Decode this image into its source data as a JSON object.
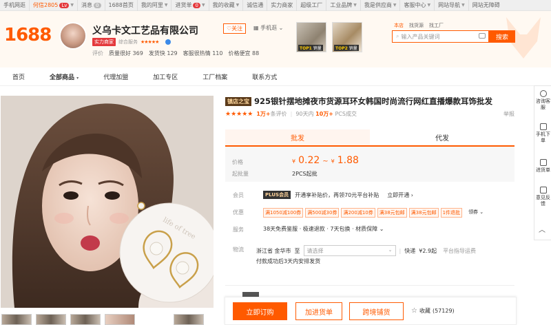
{
  "topbar": {
    "mobile": "手机网逛",
    "user": "何信2805",
    "level": "Lv",
    "messages": "消息",
    "message_count": "0",
    "links": [
      "1688首页",
      "我的阿里",
      "进货单",
      "我的收藏",
      "诚信通",
      "实力商家",
      "超级工厂",
      "工业品牌",
      "我是供应商",
      "客服中心",
      "网站导航",
      "网站无障碍"
    ],
    "cart_count": "0"
  },
  "header": {
    "logo": "1688",
    "company": "义乌卡文工艺品有限公司",
    "shili": "实力商家",
    "stars_label": "综合服务",
    "stars": "★★★★★",
    "score_label": "评价",
    "scores": [
      {
        "label": "质量很好",
        "value": "369"
      },
      {
        "label": "发货快",
        "value": "129"
      },
      {
        "label": "客服很热情",
        "value": "110"
      },
      {
        "label": "价格便宜",
        "value": "88"
      }
    ],
    "follow": "关注",
    "mobile_shop": "手机逛",
    "thumbs": [
      {
        "rank": "TOP1",
        "label": "销量"
      },
      {
        "rank": "TOP2",
        "label": "销量"
      }
    ],
    "search_tabs": [
      "本店",
      "找货源",
      "找工厂"
    ],
    "search_placeholder": "输入产品关键词",
    "search_button": "搜索"
  },
  "nav": {
    "items": [
      "首页",
      "全部商品",
      "代理加盟",
      "加工专区",
      "工厂档案",
      "联系方式"
    ]
  },
  "product": {
    "shop_badge": "镇店之宝",
    "title": "925银针摆地摊夜市货源耳环女韩国时尚流行网红直播爆款耳饰批发",
    "stars": "★★★★★",
    "reviews_num": "1万+",
    "reviews_label": "条评价",
    "days": "90天内",
    "sold_num": "10万+",
    "sold_label": "PCS成交",
    "report": "举报",
    "tabs": [
      "批发",
      "代发"
    ],
    "price_label": "价格",
    "currency": "¥",
    "price_min": "0.22",
    "price_max": "1.88",
    "min_order_label": "起批量",
    "min_order": "2PCS起批",
    "member_label": "会员",
    "plus_text": "PLUS会员",
    "plus_desc": "开通享补贴价，再领70元平台补贴",
    "plus_open": "立即开通",
    "coupon_label": "优惠",
    "coupons": [
      "满1050减100券",
      "满500减30券",
      "满200减10券",
      "满38元包邮",
      "满38元包邮",
      "1件退批"
    ],
    "coupon_more": "领券",
    "service_label": "服务",
    "service": "38天免费鉴服 · 极速退款 · 7天包换 · 材质保障",
    "logistics_label": "物流",
    "origin": "浙江省 金华市",
    "to": "至",
    "dest_placeholder": "请选择",
    "express": "快递",
    "express_fee": "¥2.9起",
    "platform_fee": "平台指导运费",
    "ship_note": "付款成功后3天内安排发货",
    "buy_now": "立即订购",
    "add_cart": "加进货单",
    "distribute": "跨境铺货",
    "fav_label": "收藏",
    "fav_count": "(57129)",
    "watermark_text": "life of tree"
  },
  "sidebar": {
    "items": [
      "咨询客服",
      "手机下单",
      "进货单",
      "意见反馈"
    ]
  },
  "colors": {
    "accent": "#ff5a00",
    "price": "#ff5a00",
    "header_bg": "#fff9f2"
  }
}
